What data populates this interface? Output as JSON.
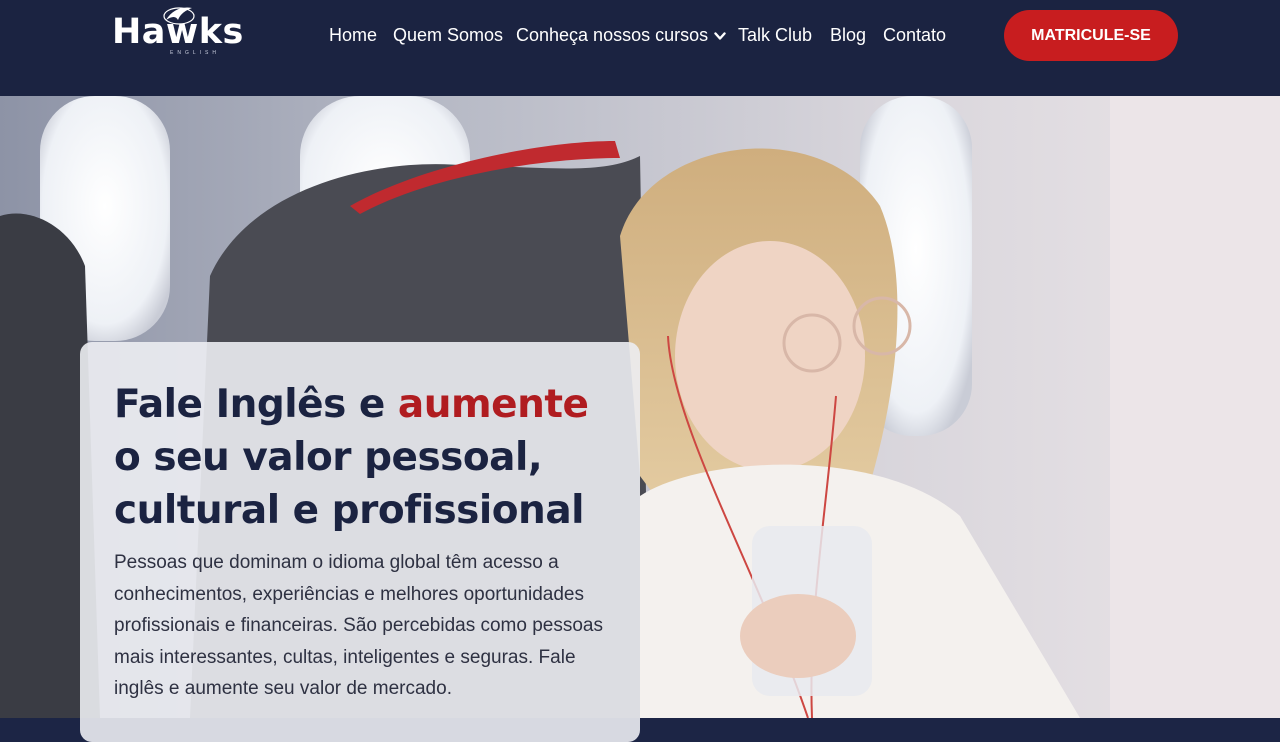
{
  "header": {
    "logo": {
      "name": "Hawks",
      "tagline": "ENGLISH"
    },
    "nav": [
      {
        "label": "Home"
      },
      {
        "label": "Quem Somos"
      },
      {
        "label": "Conheça nossos cursos"
      },
      {
        "label": "Talk Club"
      },
      {
        "label": "Blog"
      },
      {
        "label": "Contato"
      }
    ],
    "cta_label": "MATRICULE-SE"
  },
  "hero": {
    "headline": {
      "part1": "Fale Inglês e ",
      "accent": "aumente",
      "part2": " o seu valor pessoal, cultural e profissional"
    },
    "body": "Pessoas que dominam o idioma global têm acesso a conhecimentos, experiências e melhores oportunidades profissionais e financeiras. São percebidas como pessoas mais interessantes, cultas, inteligentes e seguras. Fale inglês e aumente seu valor de mercado."
  },
  "colors": {
    "header_bg": "#1b2341",
    "cta_bg": "#c81d1f",
    "headline": "#1b2341",
    "accent": "#b01c20"
  },
  "icons": [
    "hawk-logo-icon",
    "chevron-down-icon"
  ]
}
